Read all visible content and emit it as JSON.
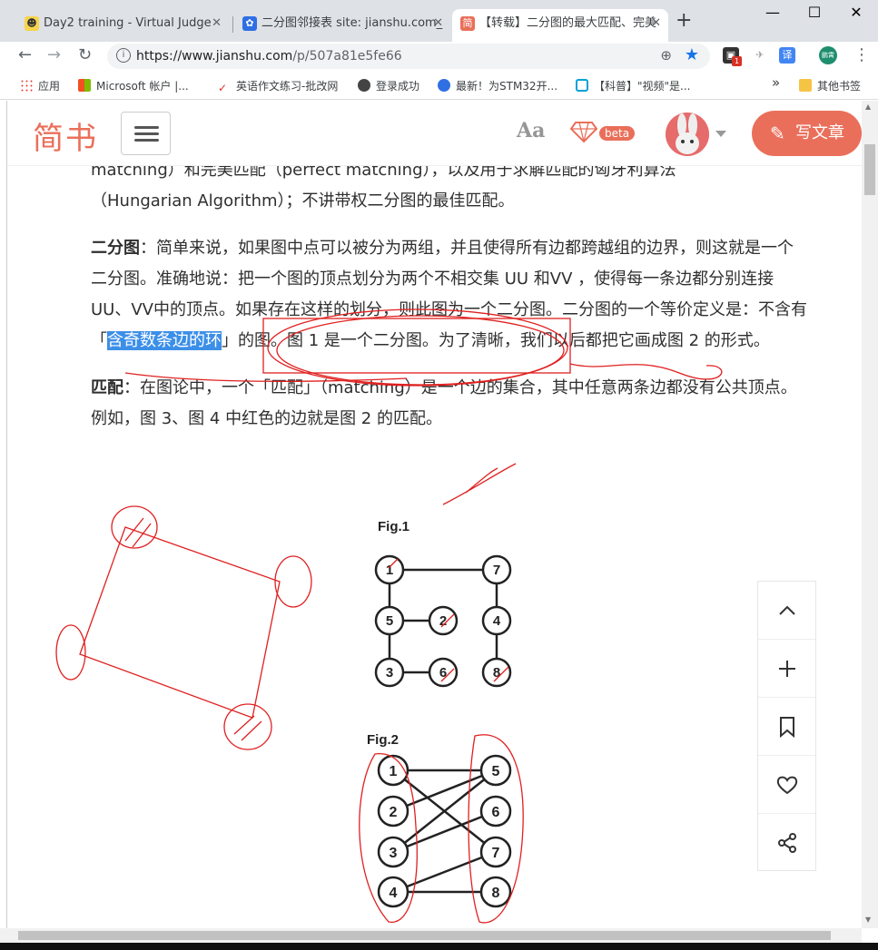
{
  "browser": {
    "tabs": [
      {
        "title": "Day2 training - Virtual Judge",
        "icon": "vjudge-icon"
      },
      {
        "title": "二分图邻接表 site: jianshu.com_",
        "icon": "baidu-paw-icon"
      },
      {
        "title": "【转载】二分图的最大匹配、完美",
        "icon": "jianshu-icon",
        "active": true
      }
    ],
    "favicon_jian": "简",
    "url_host": "https://www.jianshu.com",
    "url_path": "/p/507a81e5fe66",
    "ext_badge": "1",
    "translate_label": "译",
    "profile_label": "鹏霄",
    "bookmarks": [
      {
        "label": "应用",
        "icon": "apps-icon"
      },
      {
        "label": "Microsoft 帐户 |...",
        "icon": "microsoft-icon"
      },
      {
        "label": "英语作文练习-批改网",
        "icon": "pigai-icon"
      },
      {
        "label": "登录成功",
        "icon": "globe-icon"
      },
      {
        "label": "最新！为STM32开...",
        "icon": "baidu-paw-icon"
      },
      {
        "label": "【科普】\"视频\"是...",
        "icon": "bilibili-icon"
      }
    ],
    "bookmarks_overflow": "»",
    "other_bookmarks": "其他书签"
  },
  "site": {
    "logo": "简书",
    "aa": "Aa",
    "beta": "beta",
    "write_button": "写文章"
  },
  "article": {
    "line0": "matching）和完美匹配（perfect matching），以及用于求解匹配的匈牙利算法",
    "line1": "（Hungarian Algorithm）；不讲带权二分图的最佳匹配。",
    "p1_term": "二分图",
    "p1_a": "：简单来说，如果图中点可以被分为两组，并且使得所有边都跨越组的边界，则这就是一个二分图。准确地说：把一个图的顶点划分为两个不相交集 UU 和VV ，使得每一条边都分别连接UU、VV中的顶点。如果存在这样的划分，则此图为一个二分图。二分图的一个等价定义是：不含有「",
    "p1_highlight": "含奇数条边的环",
    "p1_b": "」的图。图 1 是一个二分图。为了清晰，我们以后都把它画成图 2 的形式。",
    "p2_term": "匹配",
    "p2_a": "：在图论中，一个「匹配」（matching）是一个边的集合，其中任意两条边都没有公共顶点。例如，图 3、图 4 中红色的边就是图 2 的匹配。"
  },
  "fig1": {
    "label": "Fig.1",
    "nodes": [
      "1",
      "7",
      "5",
      "2",
      "4",
      "3",
      "6",
      "8"
    ]
  },
  "fig2": {
    "label": "Fig.2",
    "left": [
      "1",
      "2",
      "3",
      "4"
    ],
    "right": [
      "5",
      "6",
      "7",
      "8"
    ]
  },
  "side_toolbar": [
    "chevron-up-icon",
    "plus-icon",
    "bookmark-icon",
    "heart-icon",
    "share-icon"
  ],
  "colors": {
    "brand": "#ea6f5a",
    "highlight": "#3c8fe8",
    "annotation": "#e02020"
  }
}
